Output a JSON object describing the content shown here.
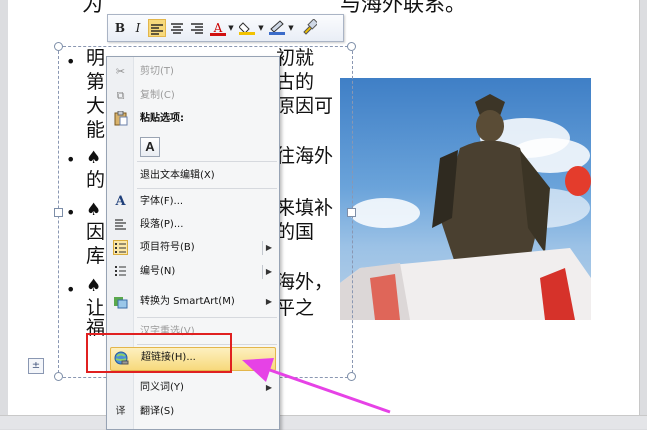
{
  "slide": {
    "title_left": "为",
    "title_right": "与海外联系。",
    "lines": [
      {
        "left": "明",
        "right": "初就"
      },
      {
        "left": "第",
        "right": "古的"
      },
      {
        "left": "大",
        "right": "原因可"
      },
      {
        "left": "能",
        "right": ""
      },
      {
        "left": "的",
        "right": "往海外"
      },
      {
        "left": "",
        "right": "来填补"
      },
      {
        "left": "因",
        "right": "的国"
      },
      {
        "left": "库",
        "right": ""
      },
      {
        "left": "",
        "right": "海外，"
      },
      {
        "left": "让",
        "right": "平之"
      },
      {
        "left": "福",
        "right": ""
      }
    ],
    "bullet_char": "•",
    "spade_char": "♠"
  },
  "toolbar": {
    "bold": "B",
    "italic": "I",
    "font_color": "A"
  },
  "menu": {
    "cut": "剪切(T)",
    "copy": "复制(C)",
    "paste_options": "粘贴选项:",
    "paste_icon": "A",
    "exit_edit": "退出文本编辑(X)",
    "font": "字体(F)...",
    "paragraph": "段落(P)...",
    "bullets": "项目符号(B)",
    "numbering": "编号(N)",
    "smartart": "转换为 SmartArt(M)",
    "chinese_convert": "汉字重选(V)",
    "hyperlink": "超链接(H)...",
    "synonyms": "同义词(Y)",
    "translate": "翻译(S)"
  },
  "colors": {
    "highlight_box": "#e02020",
    "arrow": "#e642e6",
    "menu_hover": "#f7d97c"
  }
}
